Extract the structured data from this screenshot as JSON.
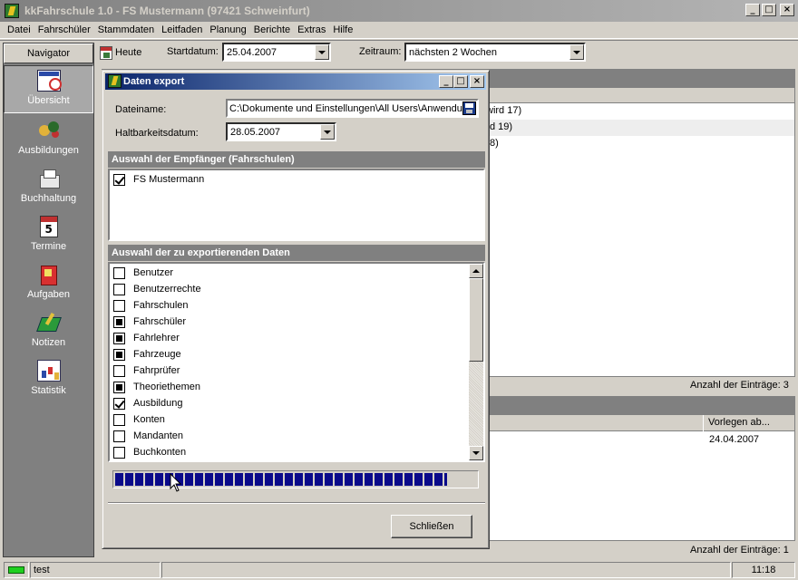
{
  "window": {
    "title": "kkFahrschule 1.0  -  FS Mustermann (97421 Schweinfurt)",
    "controls": [
      "_",
      "□",
      "×"
    ]
  },
  "menu": [
    "Datei",
    "Fahrschüler",
    "Stammdaten",
    "Leitfaden",
    "Planung",
    "Berichte",
    "Extras",
    "Hilfe"
  ],
  "toolbar": {
    "heute_label": "Heute",
    "startdatum_label": "Startdatum:",
    "startdatum_value": "25.04.2007",
    "zeitraum_label": "Zeitraum:",
    "zeitraum_value": "nächsten 2 Wochen"
  },
  "navigator": {
    "header": "Navigator",
    "items": [
      {
        "label": "Übersicht",
        "icon": "overview-icon",
        "active": true
      },
      {
        "label": "Ausbildungen",
        "icon": "training-icon"
      },
      {
        "label": "Buchhaltung",
        "icon": "accounting-icon"
      },
      {
        "label": "Termine",
        "icon": "calendar-icon"
      },
      {
        "label": "Aufgaben",
        "icon": "tasks-icon"
      },
      {
        "label": "Notizen",
        "icon": "notes-icon"
      },
      {
        "label": "Statistik",
        "icon": "statistics-icon"
      }
    ]
  },
  "background": {
    "top_rows": [
      "wird 17)",
      "d 19)",
      "8)"
    ],
    "top_count": "Anzahl der Einträge: 3",
    "bottom_col_header": "Vorlegen ab...",
    "bottom_value": "24.04.2007",
    "bottom_count": "Anzahl der Einträge: 1"
  },
  "dialog": {
    "title": "Daten export",
    "dateiname_label": "Dateiname:",
    "dateiname_value": "C:\\Dokumente und Einstellungen\\All Users\\Anwendu",
    "haltbarkeit_label": "Haltbarkeitsdatum:",
    "haltbarkeit_value": "28.05.2007",
    "section_recipients": "Auswahl der Empfänger (Fahrschulen)",
    "recipients": [
      {
        "label": "FS Mustermann",
        "state": "checked"
      }
    ],
    "section_data": "Auswahl der zu exportierenden Daten",
    "data_items": [
      {
        "label": "Benutzer",
        "state": "unchecked"
      },
      {
        "label": "Benutzerrechte",
        "state": "unchecked"
      },
      {
        "label": "Fahrschulen",
        "state": "unchecked"
      },
      {
        "label": "Fahrschüler",
        "state": "filled"
      },
      {
        "label": "Fahrlehrer",
        "state": "filled"
      },
      {
        "label": "Fahrzeuge",
        "state": "filled"
      },
      {
        "label": "Fahrprüfer",
        "state": "unchecked"
      },
      {
        "label": "Theoriethemen",
        "state": "filled"
      },
      {
        "label": "Ausbildung",
        "state": "checked"
      },
      {
        "label": "Konten",
        "state": "unchecked"
      },
      {
        "label": "Mandanten",
        "state": "unchecked"
      },
      {
        "label": "Buchkonten",
        "state": "unchecked"
      }
    ],
    "progress": 0.92,
    "close_label": "Schließen"
  },
  "statusbar": {
    "user": "test",
    "time": "11:18"
  },
  "colors": {
    "dialog_title_start": "#0a246a",
    "dialog_title_end": "#a6caf0",
    "progress": "#0a0a8a",
    "status_led": "#1fd01f"
  }
}
